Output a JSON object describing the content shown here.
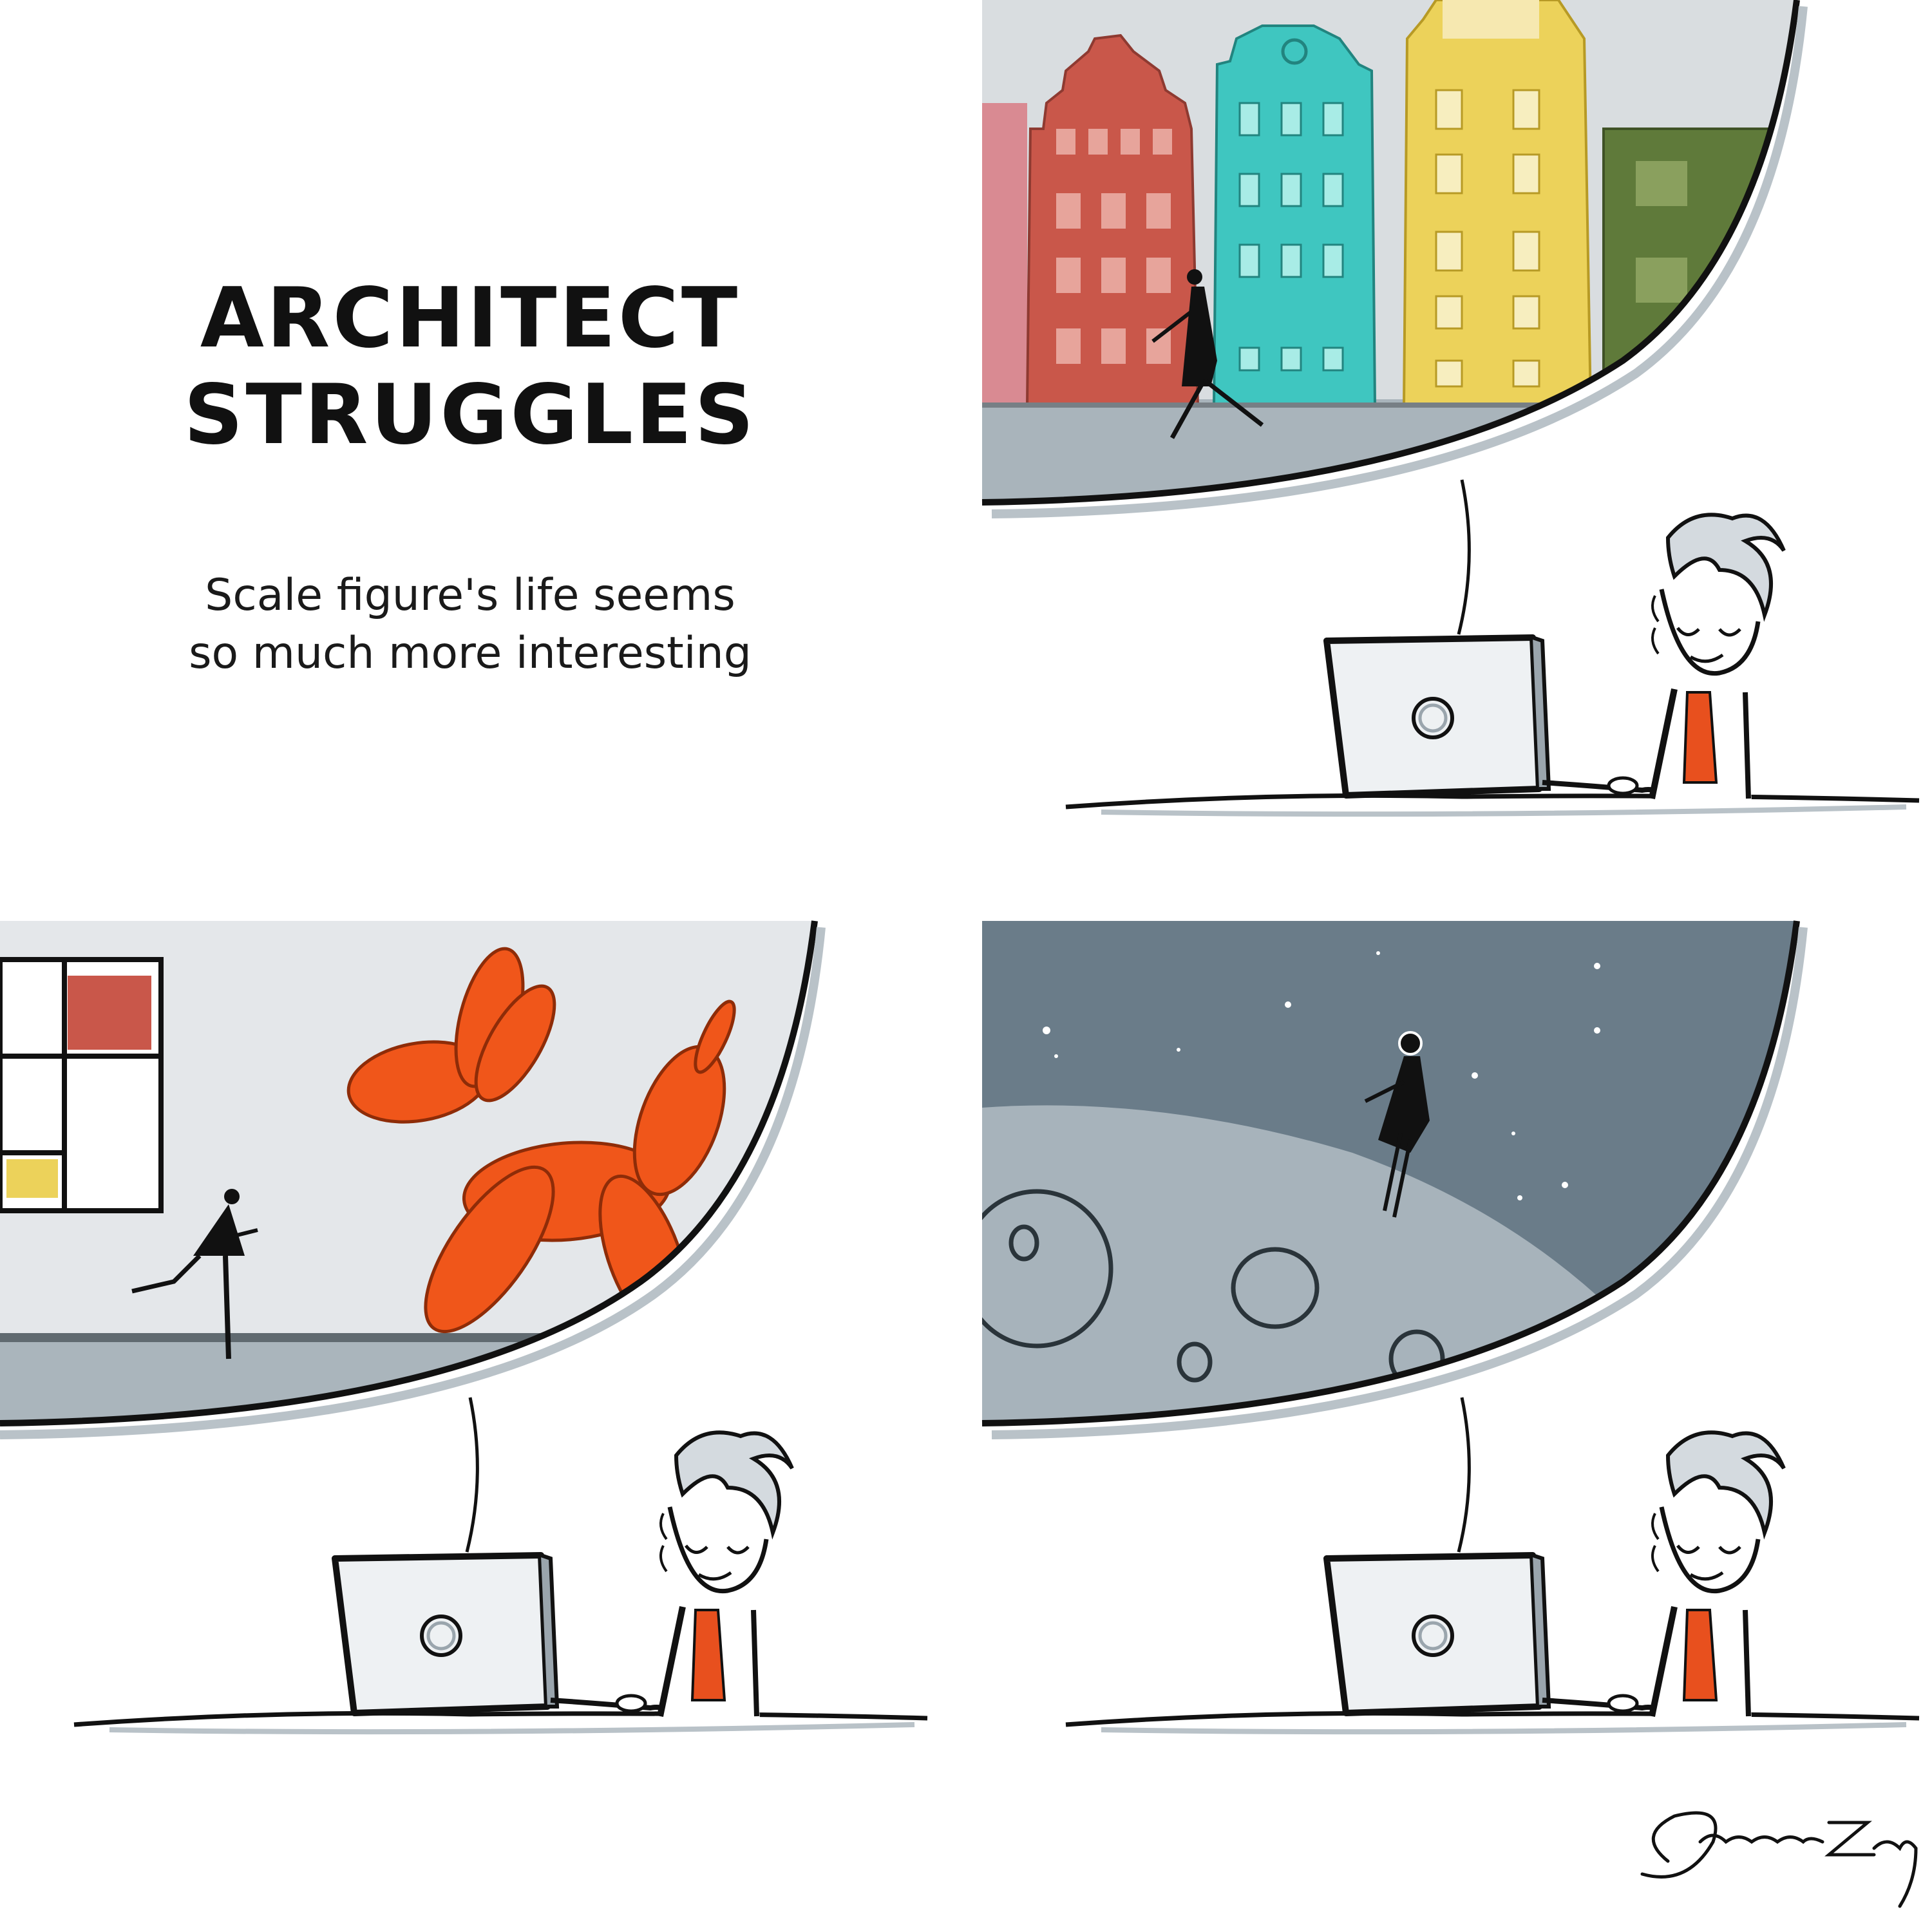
{
  "title": {
    "line1": "ARCHITECT",
    "line2": "STRUGGLES"
  },
  "subtitle": {
    "line1": "Scale figure's life seems",
    "line2": "so much more interesting"
  },
  "signature": "SnowriiZhang",
  "panels": [
    {
      "scene": "colorful-townhouses"
    },
    {
      "scene": "balloon-dog-gallery"
    },
    {
      "scene": "moon-surface"
    }
  ],
  "colors": {
    "ink": "#111111",
    "sweater": "#e8501e",
    "balloon": "#f0561a",
    "red_house": "#c9574a",
    "teal_house": "#3fc6c0",
    "yellow_house": "#ecd25a",
    "pink_house": "#d98a92",
    "green_house": "#5f7a3a",
    "gallery_wall": "#e4e7ea",
    "space": "#6a7c89",
    "moon": "#a7b3bb"
  }
}
